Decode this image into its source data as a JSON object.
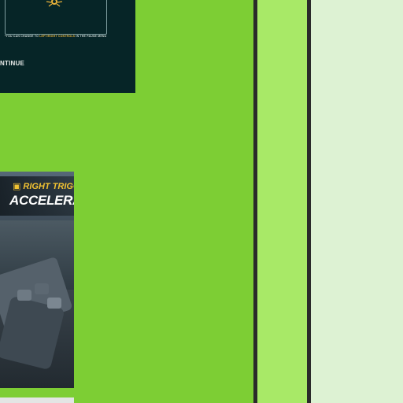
{
  "tutorial_card": {
    "note_prefix": "*YOU CAN CHANGE TO ",
    "note_highlight": "LEFT/RIGHT CONTROLS",
    "note_suffix": " IN THE PAUSE MENU",
    "continue_label": "NTINUE"
  },
  "gameplay_card": {
    "line1": "RIGHT TRIGGE",
    "line2": "ACCELERATI"
  },
  "colors": {
    "canvas": "#7dce34",
    "middle_column": "#a8e967",
    "right_column": "#ddf2d3",
    "divider": "#2a2a2a",
    "card_dark": "#062527",
    "accent_yellow": "#f1c232"
  }
}
